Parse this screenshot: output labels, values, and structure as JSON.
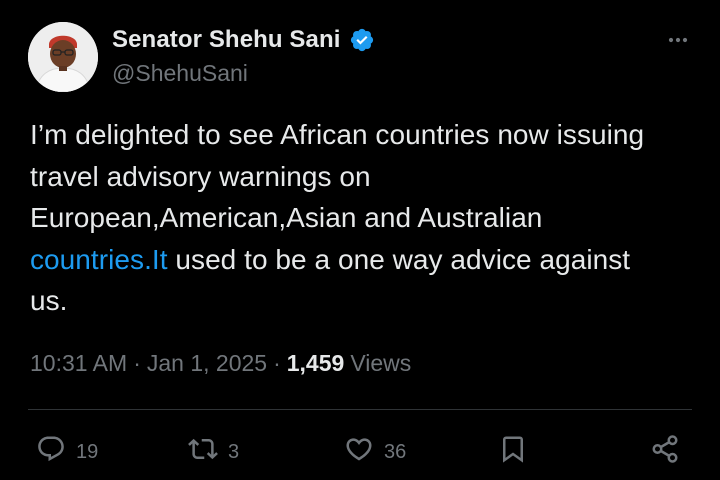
{
  "author": {
    "display_name": "Senator Shehu Sani",
    "handle": "@ShehuSani",
    "verified": true,
    "accent_color": "#1d9bf0"
  },
  "tweet": {
    "text_lines": [
      "I’m delighted to see African countries now issuing",
      "travel advisory warnings on",
      "European,American,Asian and Australian"
    ],
    "link_text": "countries.It",
    "line4_rest": " used to be a one way advice against",
    "line5": "us."
  },
  "meta": {
    "time": "10:31 AM",
    "separator": "·",
    "date": "Jan 1, 2025",
    "views_count": "1,459",
    "views_label": "Views"
  },
  "actions": {
    "replies": "19",
    "reposts": "3",
    "likes": "36"
  },
  "icons": [
    "more-icon",
    "verified-badge-icon",
    "reply-icon",
    "repost-icon",
    "like-icon",
    "bookmark-icon",
    "share-icon"
  ],
  "colors": {
    "background": "#000000",
    "text_primary": "#e7e9ea",
    "text_secondary": "#71767b",
    "link": "#1d9bf0",
    "divider": "#2f3336"
  }
}
